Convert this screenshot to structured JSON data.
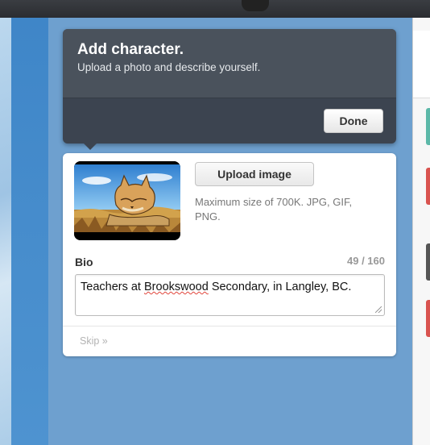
{
  "dialog": {
    "title": "Add character.",
    "subtitle": "Upload a photo and describe yourself.",
    "done_label": "Done"
  },
  "profile": {
    "upload_label": "Upload image",
    "upload_note": "Maximum size of 700K. JPG, GIF, PNG.",
    "bio_label": "Bio",
    "bio_count": "49 / 160",
    "bio_before": "Teachers at ",
    "bio_spell": "Brookswood",
    "bio_after": " Secondary, in Langley, BC.",
    "skip_label": "Skip »"
  },
  "colors": {
    "dialog_bg": "#3c4450",
    "page_bg": "#6ea0cf",
    "accent_chips": [
      "#5cb8a8",
      "#d9534f",
      "#555555",
      "#d9534f"
    ]
  },
  "icons": [
    "avatar-lynx-image",
    "resize-handle-icon"
  ]
}
